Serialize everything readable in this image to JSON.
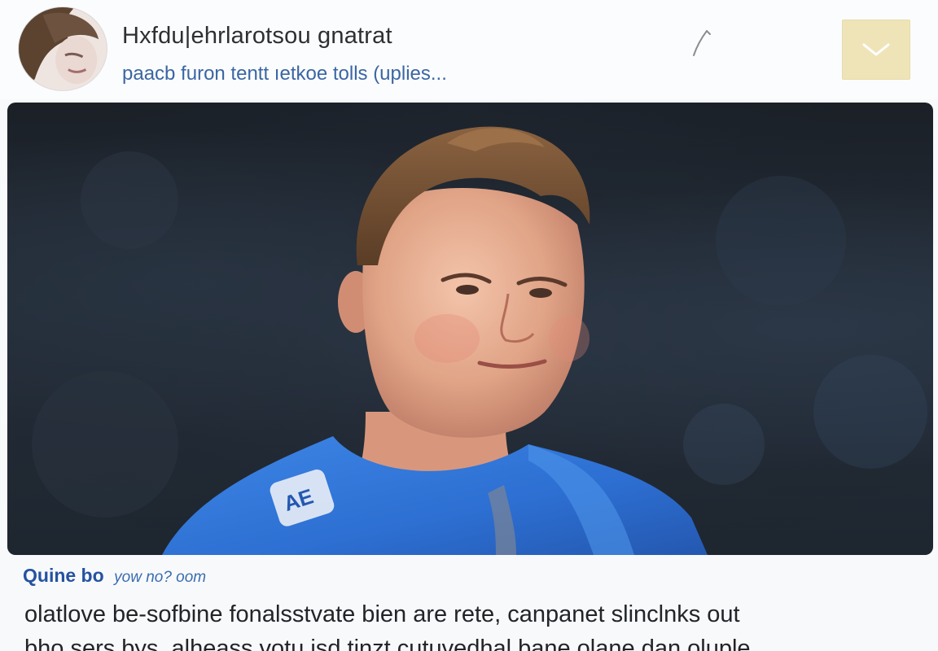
{
  "header": {
    "author_name": "Hxfdu|ehrlarotsou gnatrat",
    "author_sub": "paacb furon tentt ıetkoe tolls (uplies...",
    "avatar_icon": "avatar-photo",
    "pen_icon": "pen-icon",
    "menu_icon": "chevron-down-icon",
    "menu_color": "#efe4b8"
  },
  "photo": {
    "subject": "athlete-portrait"
  },
  "caption": {
    "handle": "Quine bo",
    "time": "yow no? oom",
    "lines": [
      "olatlove be-sofbine fonalsstvate bien are rete, canpanet slinclnks out",
      "bho sers bys. alheass votu isd tinzt cutuvedhal bane olane dan oluple"
    ]
  },
  "colors": {
    "accent": "#2552a0",
    "link": "#3b66a3",
    "text": "#222428"
  }
}
